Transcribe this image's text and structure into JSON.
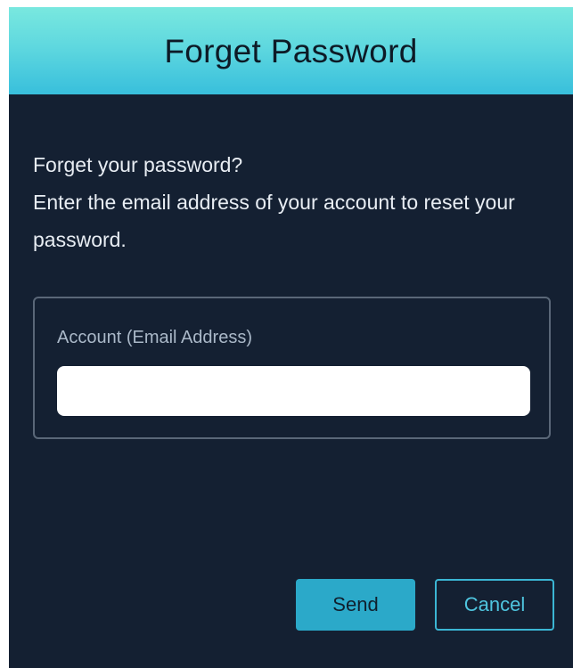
{
  "dialog": {
    "title": "Forget Password",
    "instructions": {
      "line1": "Forget your password?",
      "line2": "Enter the email address of your account to reset your password."
    },
    "account_field": {
      "label": "Account (Email Address)",
      "value": "",
      "placeholder": ""
    },
    "buttons": {
      "send": "Send",
      "cancel": "Cancel"
    }
  },
  "colors": {
    "background": "#142032",
    "header_gradient_top": "#79e8df",
    "header_gradient_bottom": "#38bfdc",
    "accent": "#2ba9c9",
    "field_border": "#5a6778"
  }
}
